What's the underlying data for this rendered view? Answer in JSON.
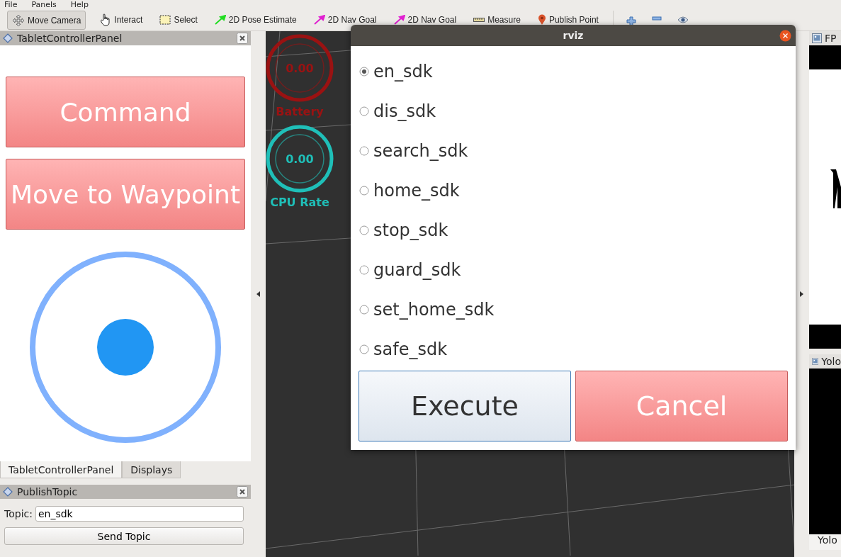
{
  "menu": [
    {
      "label": "File"
    },
    {
      "label": "Panels"
    },
    {
      "label": "Help"
    }
  ],
  "toolbar": {
    "tools": [
      {
        "label": "Move Camera",
        "kind": "move",
        "selected": true
      },
      {
        "label": "Interact",
        "kind": "hand",
        "selected": false
      },
      {
        "label": "Select",
        "kind": "select",
        "selected": false
      },
      {
        "label": "2D Pose Estimate",
        "kind": "green-arrow",
        "selected": false
      },
      {
        "label": "2D Nav Goal",
        "kind": "pink-arrow",
        "selected": false
      },
      {
        "label": "2D Nav Goal",
        "kind": "pink-arrow",
        "selected": false
      },
      {
        "label": "Measure",
        "kind": "ruler",
        "selected": false
      },
      {
        "label": "Publish Point",
        "kind": "pin",
        "selected": false
      }
    ],
    "view_buttons": [
      {
        "kind": "plus"
      },
      {
        "kind": "minus"
      },
      {
        "kind": "eye"
      }
    ]
  },
  "left_panel": {
    "title": "TabletControllerPanel",
    "buttons": [
      "Command",
      "Move to Waypoint"
    ]
  },
  "tabs": [
    {
      "label": "TabletControllerPanel",
      "selected": true
    },
    {
      "label": "Displays",
      "selected": false
    }
  ],
  "publish_panel": {
    "title": "PublishTopic",
    "topic_label": "Topic:",
    "topic_value": "en_sdk",
    "send_button": "Send Topic"
  },
  "gauges": [
    {
      "value": "0.00",
      "label": "Battery",
      "color": "#9a1212"
    },
    {
      "value": "0.00",
      "label": "CPU Rate",
      "color": "#1fbfb8"
    }
  ],
  "dialog": {
    "title": "rviz",
    "options": [
      {
        "label": "en_sdk",
        "selected": true
      },
      {
        "label": "dis_sdk",
        "selected": false
      },
      {
        "label": "search_sdk",
        "selected": false
      },
      {
        "label": "home_sdk",
        "selected": false
      },
      {
        "label": "stop_sdk",
        "selected": false
      },
      {
        "label": "guard_sdk",
        "selected": false
      },
      {
        "label": "set_home_sdk",
        "selected": false
      },
      {
        "label": "safe_sdk",
        "selected": false
      }
    ],
    "execute": "Execute",
    "cancel": "Cancel"
  },
  "right_panels": [
    {
      "title": "FP"
    },
    {
      "title": "Yolo"
    }
  ],
  "right_tab": "Yolo"
}
